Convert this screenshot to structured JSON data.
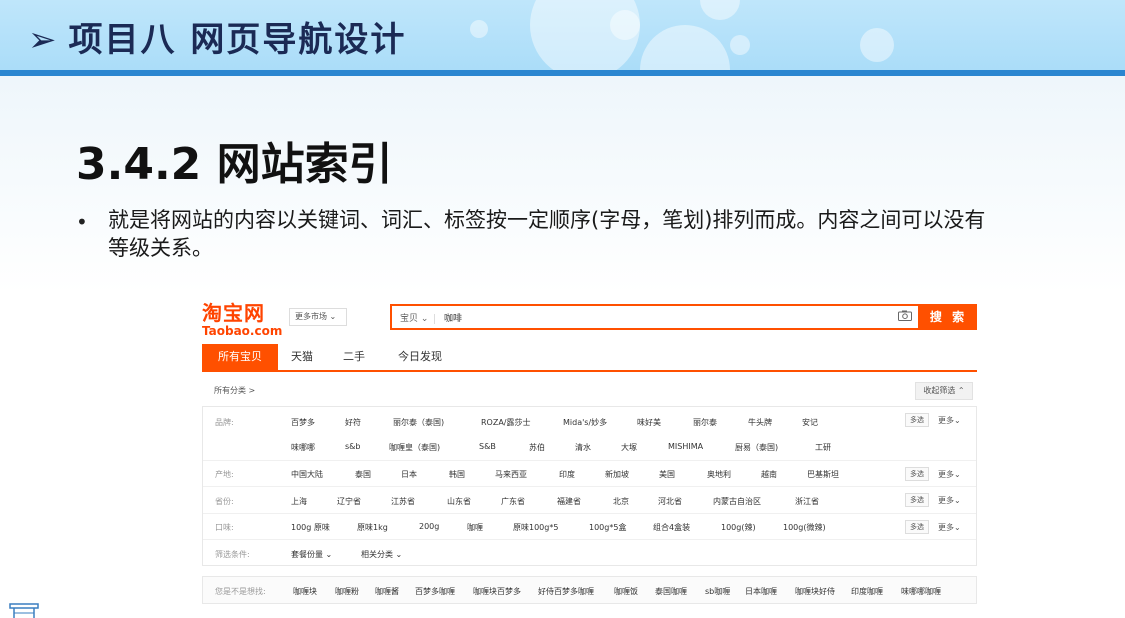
{
  "slide": {
    "header_title": "项目八  网页导航设计",
    "header_arrow": "➢",
    "section_title": "3.4.2  网站索引",
    "bullet": "•",
    "bullet_text": "就是将网站的内容以关键词、词汇、标签按一定顺序(字母，笔划)排列而成。内容之间可以没有等级关系。"
  },
  "colors": {
    "accent": "#ff5000",
    "header_bg": "#bfe6fb",
    "header_bar": "#2a86d0"
  },
  "taobao": {
    "logo_cn": "淘宝网",
    "logo_en": "Taobao.com",
    "market_btn": "更多市场 ⌄",
    "search_type": "宝贝 ⌄",
    "search_query": "咖啡",
    "camera_icon": "camera-icon",
    "search_btn": "搜 索",
    "tabs": [
      "所有宝贝",
      "天猫",
      "二手",
      "今日发现"
    ],
    "crumb": "所有分类 >",
    "collapse_btn": "收起筛选 ⌃",
    "filters": {
      "brand": {
        "label": "品牌:",
        "row1": [
          "百梦多",
          "好符",
          "丽尔泰（泰国)",
          "ROZA/露莎士",
          "Mida's/妙多",
          "味好美",
          "丽尔泰",
          "牛头牌",
          "安记"
        ],
        "row2": [
          "味哪哪",
          "s&b",
          "咖喱皇（泰国)",
          "S&B",
          "苏伯",
          "清水",
          "大塚",
          "MISHIMA",
          "厨易（泰国)",
          "工研"
        ]
      },
      "origin": {
        "label": "产地:",
        "items": [
          "中国大陆",
          "泰国",
          "日本",
          "韩国",
          "马来西亚",
          "印度",
          "新加坡",
          "美国",
          "奥地利",
          "越南",
          "巴基斯坦"
        ]
      },
      "province": {
        "label": "省份:",
        "items": [
          "上海",
          "辽宁省",
          "江苏省",
          "山东省",
          "广东省",
          "福建省",
          "北京",
          "河北省",
          "内蒙古自治区",
          "浙江省"
        ]
      },
      "flavor": {
        "label": "口味:",
        "items": [
          "100g 原味",
          "原味1kg",
          "200g",
          "咖喱",
          "原味100g*5",
          "100g*5盒",
          "组合4盒装",
          "100g(辣)",
          "100g(微辣)"
        ]
      },
      "conditions": {
        "label": "筛选条件:",
        "items": [
          "套餐份量 ⌄",
          "相关分类 ⌄"
        ]
      },
      "multi_label": "多选",
      "more_label": "更多⌄"
    },
    "related": {
      "label": "您是不是想找:",
      "items": [
        "咖喱块",
        "咖喱粉",
        "咖喱酱",
        "百梦多咖喱",
        "咖喱块百梦多",
        "好侍百梦多咖喱",
        "咖喱饭",
        "泰国咖喱",
        "sb咖喱",
        "日本咖喱",
        "咖喱块好侍",
        "印度咖喱",
        "味哪哪咖喱"
      ]
    }
  }
}
